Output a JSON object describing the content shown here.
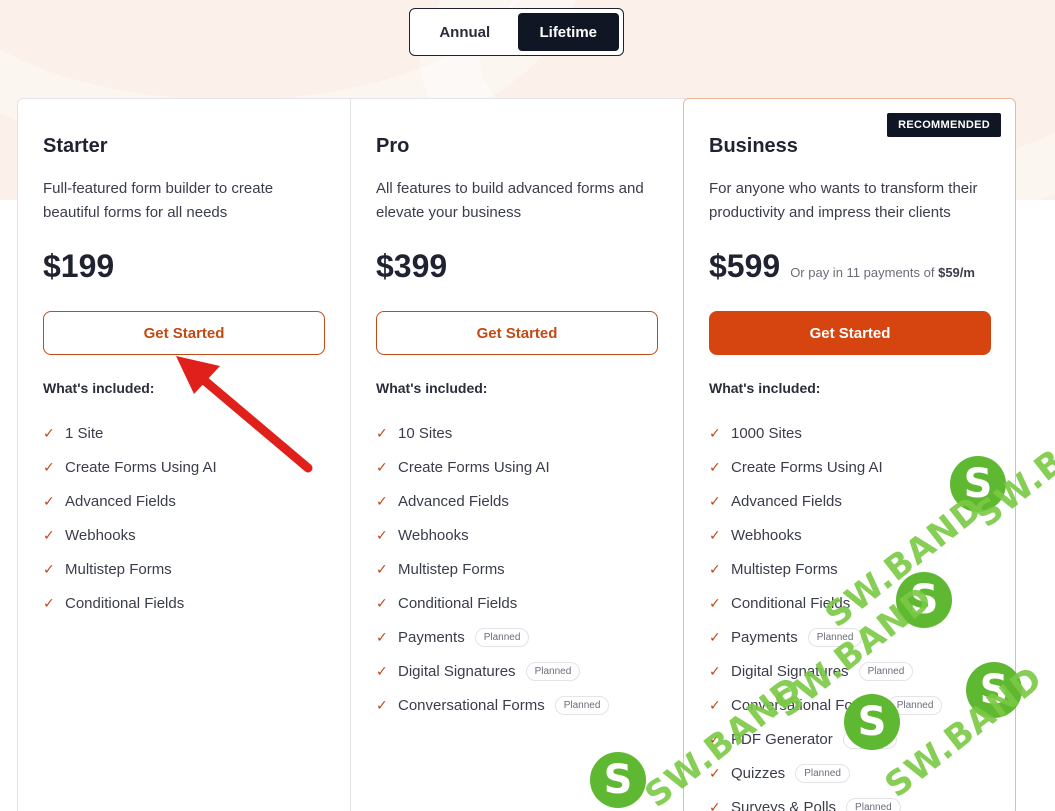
{
  "toggle": {
    "annual": "Annual",
    "lifetime": "Lifetime",
    "selected": "Lifetime"
  },
  "plans": [
    {
      "name": "Starter",
      "description": "Full-featured form builder to create beautiful forms for all needs",
      "price": "$199",
      "cta": "Get Started",
      "included_label": "What's included:",
      "features": [
        "1 Site",
        "Create Forms Using AI",
        "Advanced Fields",
        "Webhooks",
        "Multistep Forms",
        "Conditional Fields"
      ]
    },
    {
      "name": "Pro",
      "description": "All features to build advanced forms and elevate your business",
      "price": "$399",
      "cta": "Get Started",
      "included_label": "What's included:",
      "features": [
        "10 Sites",
        "Create Forms Using AI",
        "Advanced Fields",
        "Webhooks",
        "Multistep Forms",
        "Conditional Fields",
        "Payments",
        "Digital Signatures",
        "Conversational Forms"
      ],
      "planned_label": "Planned"
    },
    {
      "name": "Business",
      "badge": "RECOMMENDED",
      "description": "For anyone who wants to transform their productivity and impress their clients",
      "price": "$599",
      "price_note_prefix": "Or pay in 11 payments of",
      "price_note_amount": "$59/m",
      "cta": "Get Started",
      "included_label": "What's included:",
      "features": [
        "1000 Sites",
        "Create Forms Using AI",
        "Advanced Fields",
        "Webhooks",
        "Multistep Forms",
        "Conditional Fields",
        "Payments",
        "Digital Signatures",
        "Conversational Forms",
        "PDF Generator",
        "Quizzes",
        "Surveys & Polls"
      ],
      "planned_label": "Planned"
    }
  ],
  "watermark": {
    "text": "SW.BAND",
    "logo_letter": "S"
  },
  "colors": {
    "accent": "#d64510",
    "dark": "#111624",
    "watermark": "#5fb832",
    "annotation_arrow": "#e0201b"
  }
}
